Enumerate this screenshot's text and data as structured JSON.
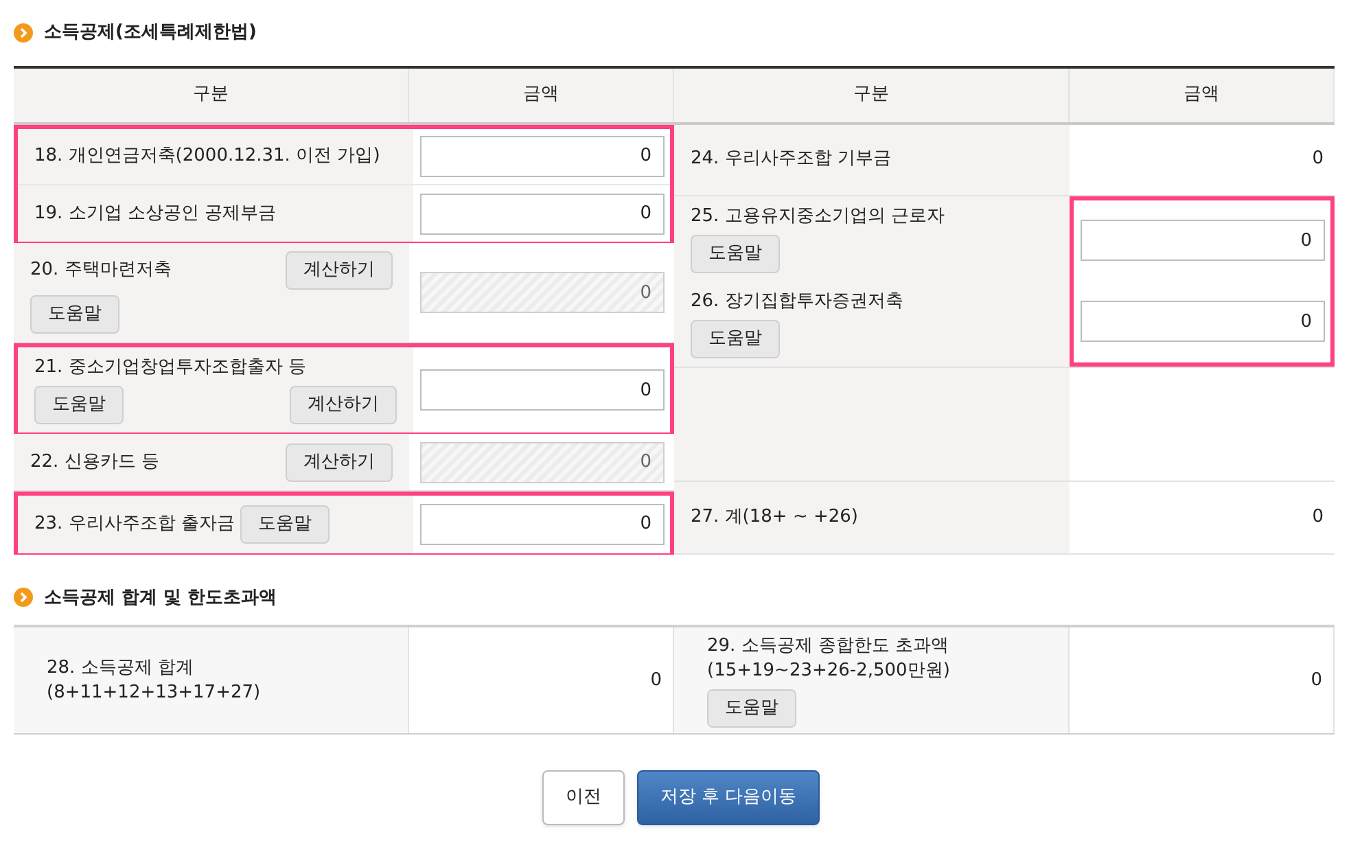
{
  "section1": {
    "title": "소득공제(조세특례제한법)",
    "columns": [
      "구분",
      "금액",
      "구분",
      "금액"
    ],
    "left": [
      {
        "highlighted": true,
        "rows": [
          {
            "label": "18. 개인연금저축(2000.12.31. 이전 가입)",
            "amount": {
              "kind": "input",
              "value": "0"
            }
          },
          {
            "label": "19. 소기업 소상공인 공제부금",
            "amount": {
              "kind": "input",
              "value": "0"
            }
          }
        ]
      },
      {
        "highlighted": false,
        "rows": [
          {
            "label": "20. 주택마련저축",
            "buttons": [
              {
                "kind": "calc",
                "label": "계산하기"
              }
            ],
            "buttons_below": [
              {
                "kind": "help",
                "label": "도움말"
              }
            ],
            "amount": {
              "kind": "locked",
              "value": "0"
            }
          }
        ]
      },
      {
        "highlighted": true,
        "rows": [
          {
            "label": "21. 중소기업창업투자조합출자 등",
            "buttons_below": [
              {
                "kind": "help",
                "label": "도움말"
              },
              {
                "kind": "calc",
                "label": "계산하기"
              }
            ],
            "amount": {
              "kind": "input",
              "value": "0"
            }
          }
        ]
      },
      {
        "highlighted": false,
        "rows": [
          {
            "label": "22. 신용카드 등",
            "buttons": [
              {
                "kind": "calc",
                "label": "계산하기"
              }
            ],
            "amount": {
              "kind": "locked",
              "value": "0"
            }
          }
        ]
      },
      {
        "highlighted": true,
        "rows": [
          {
            "label": "23. 우리사주조합 출자금",
            "buttons": [
              {
                "kind": "help",
                "label": "도움말"
              }
            ],
            "amount": {
              "kind": "input",
              "value": "0"
            }
          }
        ]
      }
    ],
    "right": [
      {
        "amount_highlighted": false,
        "rows": [
          {
            "label": "24. 우리사주조합 기부금",
            "amount": {
              "kind": "text",
              "value": "0"
            }
          }
        ]
      },
      {
        "amount_highlighted": true,
        "rows": [
          {
            "label": "25. 고용유지중소기업의 근로자",
            "buttons_below": [
              {
                "kind": "help",
                "label": "도움말"
              }
            ],
            "amount": {
              "kind": "input",
              "value": "0"
            }
          },
          {
            "label": "26. 장기집합투자증권저축",
            "buttons_below": [
              {
                "kind": "help",
                "label": "도움말"
              }
            ],
            "amount": {
              "kind": "input",
              "value": "0"
            }
          }
        ]
      },
      {
        "amount_highlighted": false,
        "rows": [
          {
            "kind": "blank"
          }
        ]
      },
      {
        "amount_highlighted": false,
        "rows": [
          {
            "label": "27. 계(18+ ~ +26)",
            "amount": {
              "kind": "text",
              "value": "0"
            }
          }
        ]
      }
    ]
  },
  "section2": {
    "title": "소득공제 합계 및 한도초과액",
    "cells": [
      {
        "label": "28. 소득공제 합계(8+11+12+13+17+27)",
        "amount": {
          "kind": "text",
          "value": "0"
        }
      },
      {
        "label": "29. 소득공제 종합한도 초과액(15+19~23+26-2,500만원)",
        "buttons_below": [
          {
            "kind": "help",
            "label": "도움말"
          }
        ],
        "amount": {
          "kind": "text",
          "value": "0"
        }
      }
    ]
  },
  "actions": [
    {
      "kind": "secondary",
      "label": "이전"
    },
    {
      "kind": "primary",
      "label": "저장 후 다음이동"
    }
  ]
}
